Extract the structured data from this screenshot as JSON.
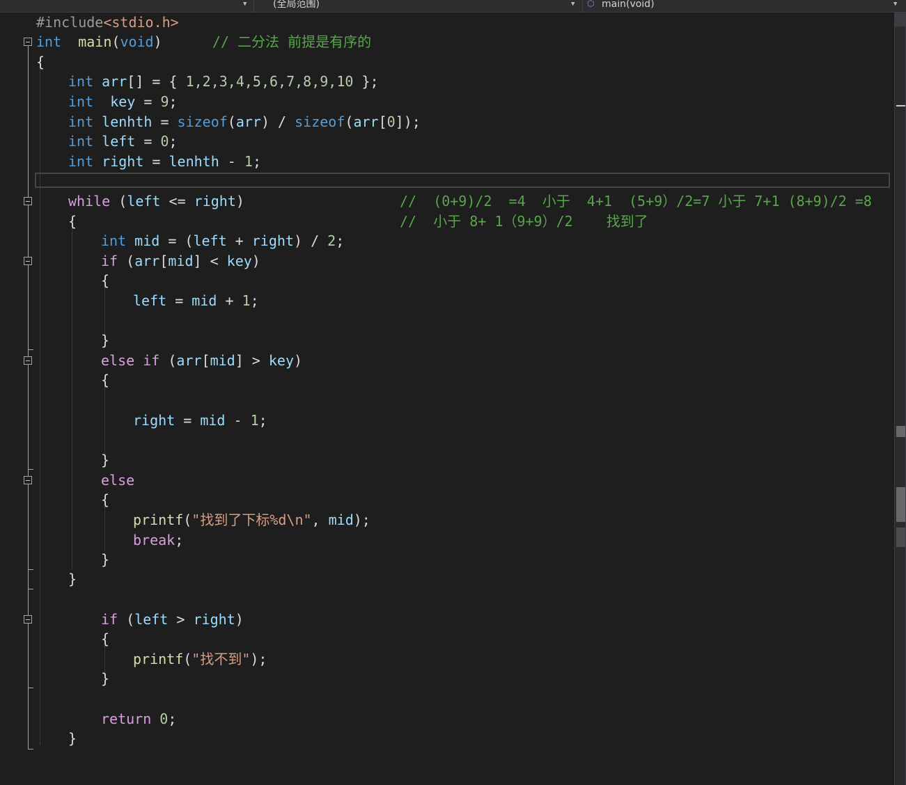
{
  "navbar": {
    "scope_label": "(全局范围)",
    "function_label": "main(void)",
    "function_icon": "cube-icon",
    "split_icon": "split-window-icon"
  },
  "code": {
    "line1": {
      "pp": "#include",
      "inc": "<stdio.h>"
    },
    "line2": {
      "type": "int",
      "name": "main",
      "open": "(",
      "param": "void",
      "close": ")",
      "comment": "// 二分法 前提是有序的"
    },
    "line3": "{",
    "line4": {
      "type": "int",
      "name": "arr",
      "rest1": "[] = { ",
      "values": "1,2,3,4,5,6,7,8,9,10",
      "rest2": " };"
    },
    "line5": {
      "type": "int",
      "name": "key",
      "eq": " = ",
      "value": "9",
      "end": ";"
    },
    "line6": {
      "type": "int",
      "name": "lenhth",
      "eq": " = ",
      "fn1": "sizeof",
      "p1": "(",
      "arg1": "arr",
      "p2": ")",
      "div": " / ",
      "fn2": "sizeof",
      "p3": "(",
      "arg2": "arr",
      "idx1": "[",
      "zero": "0",
      "idx2": "]",
      "p4": ")",
      "end": ";"
    },
    "line7": {
      "type": "int",
      "name": "left",
      "eq": " = ",
      "value": "0",
      "end": ";"
    },
    "line8": {
      "type": "int",
      "name": "right",
      "eq": " = ",
      "ref": "lenhth",
      "minus": " - ",
      "value": "1",
      "end": ";"
    },
    "line10": {
      "kw": "while",
      "open": " (",
      "a": "left",
      "op": " <= ",
      "b": "right",
      "close": ")",
      "comment": "//  (0+9)/2  =4  小于  4+1  (5+9）/2=7 小于 7+1 (8+9)/2 =8"
    },
    "line11": {
      "brace": "{",
      "comment": "//  小于 8+ 1（9+9）/2    找到了"
    },
    "line12": {
      "type": "int",
      "name": "mid",
      "eq": " = (",
      "a": "left",
      "plus": " + ",
      "b": "right",
      "div": ") / ",
      "value": "2",
      "end": ";"
    },
    "line13": {
      "kw": "if",
      "open": " (",
      "arr": "arr",
      "b1": "[",
      "mid": "mid",
      "b2": "]",
      "op": " < ",
      "key": "key",
      "close": ")"
    },
    "line14": "{",
    "line15": {
      "var": "left",
      "eq": " = ",
      "mid": "mid",
      "plus": " + ",
      "value": "1",
      "end": ";"
    },
    "line17": "}",
    "line18": {
      "kw1": "else",
      "kw2": "if",
      "open": " (",
      "arr": "arr",
      "b1": "[",
      "mid": "mid",
      "b2": "]",
      "op": " > ",
      "key": "key",
      "close": ")"
    },
    "line19": "{",
    "line21": {
      "var": "right",
      "eq": " = ",
      "mid": "mid",
      "minus": " - ",
      "value": "1",
      "end": ";"
    },
    "line23": "}",
    "line24": {
      "kw": "else"
    },
    "line25": "{",
    "line26": {
      "fn": "printf",
      "open": "(",
      "str": "\"找到了下标%d\\n\"",
      "comma": ", ",
      "var": "mid",
      "close": ");"
    },
    "line27": {
      "kw": "break",
      "end": ";"
    },
    "line28": "}",
    "line29": "}",
    "line31": {
      "kw": "if",
      "open": " (",
      "a": "left",
      "op": " > ",
      "b": "right",
      "close": ")"
    },
    "line32": "{",
    "line33": {
      "fn": "printf",
      "open": "(",
      "str": "\"找不到\"",
      "close": ");"
    },
    "line34": "}",
    "line36": {
      "kw": "return",
      "sp": " ",
      "value": "0",
      "end": ";"
    },
    "line37": "}"
  }
}
